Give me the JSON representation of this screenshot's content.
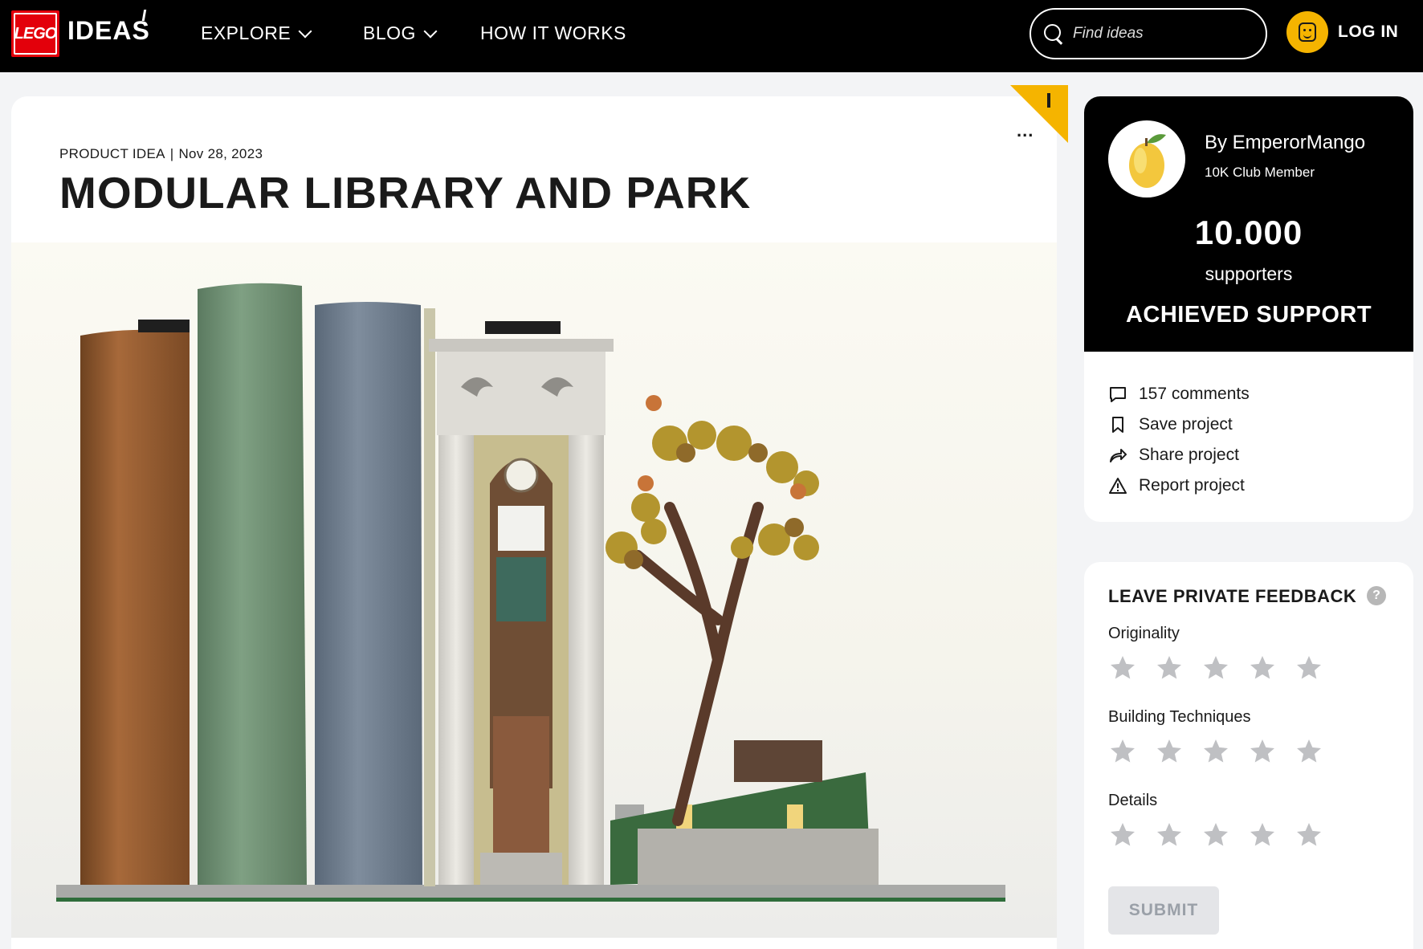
{
  "header": {
    "logo_text": "LEGO",
    "brand": "IDEAS",
    "nav": [
      {
        "label": "EXPLORE",
        "has_dropdown": true
      },
      {
        "label": "BLOG",
        "has_dropdown": true
      },
      {
        "label": "HOW IT WORKS",
        "has_dropdown": false
      }
    ],
    "search_placeholder": "Find ideas",
    "login_label": "LOG IN"
  },
  "project": {
    "type": "PRODUCT IDEA",
    "date": "Nov 28, 2023",
    "title": "MODULAR LIBRARY AND PARK",
    "more_label": "..."
  },
  "support": {
    "author": "By EmperorMango",
    "badge": "10K Club Member",
    "count": "10.000",
    "count_label": "supporters",
    "status": "ACHIEVED SUPPORT"
  },
  "actions": [
    {
      "label": "157 comments",
      "icon": "comment-icon"
    },
    {
      "label": "Save project",
      "icon": "bookmark-icon"
    },
    {
      "label": "Share project",
      "icon": "share-icon"
    },
    {
      "label": "Report project",
      "icon": "warning-icon"
    }
  ],
  "feedback": {
    "title": "LEAVE PRIVATE FEEDBACK",
    "help": "?",
    "criteria": [
      {
        "label": "Originality",
        "stars": 5
      },
      {
        "label": "Building Techniques",
        "stars": 5
      },
      {
        "label": "Details",
        "stars": 5
      }
    ],
    "submit_label": "SUBMIT"
  },
  "colors": {
    "brand_red": "#e3000b",
    "accent_yellow": "#f5b400",
    "header_bg": "#000000",
    "star_gray": "#bfc0c3"
  }
}
